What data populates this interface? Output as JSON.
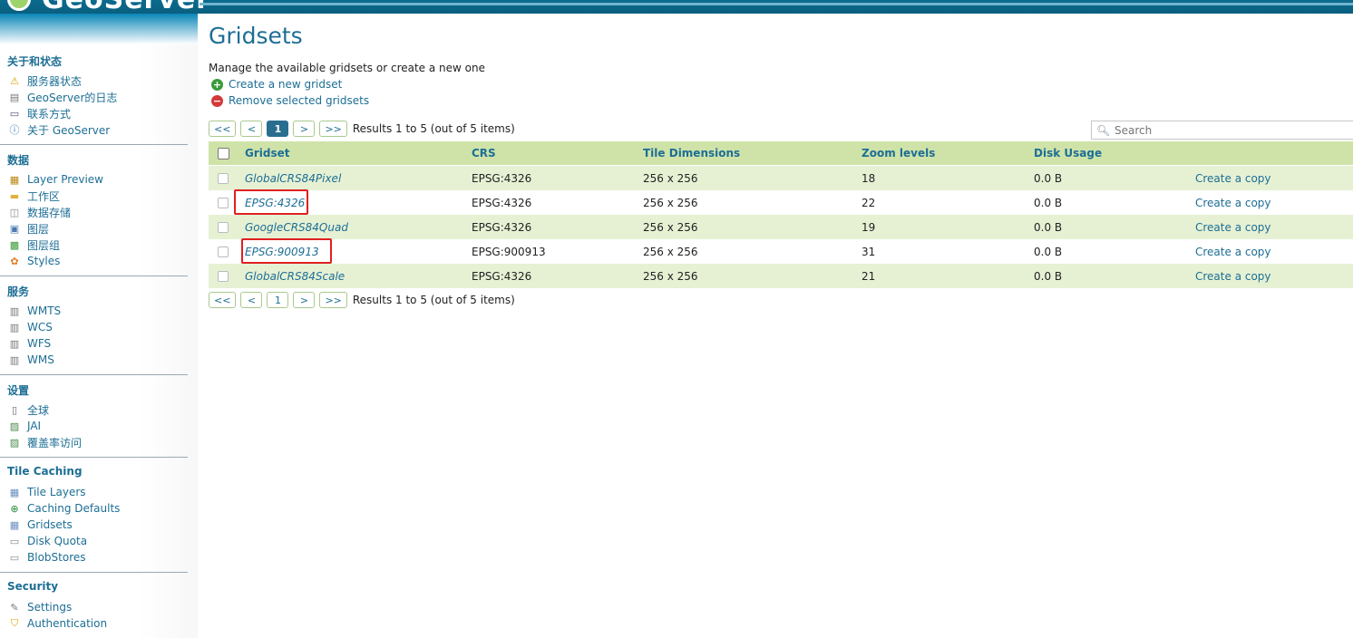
{
  "header": {
    "logo_text": "GeoServer"
  },
  "sidebar": {
    "sections": [
      {
        "title": "关于和状态",
        "items": [
          {
            "label": "服务器状态",
            "icon": "warning-icon"
          },
          {
            "label": "GeoServer的日志",
            "icon": "document-icon"
          },
          {
            "label": "联系方式",
            "icon": "contact-card-icon"
          },
          {
            "label": "关于 GeoServer",
            "icon": "info-icon"
          }
        ]
      },
      {
        "title": "数据",
        "items": [
          {
            "label": "Layer Preview",
            "icon": "map-preview-icon"
          },
          {
            "label": "工作区",
            "icon": "folder-icon"
          },
          {
            "label": "数据存储",
            "icon": "database-icon"
          },
          {
            "label": "图层",
            "icon": "layer-icon"
          },
          {
            "label": "图层组",
            "icon": "layer-group-icon"
          },
          {
            "label": "Styles",
            "icon": "palette-icon"
          }
        ]
      },
      {
        "title": "服务",
        "items": [
          {
            "label": "WMTS",
            "icon": "service-icon"
          },
          {
            "label": "WCS",
            "icon": "service-icon"
          },
          {
            "label": "WFS",
            "icon": "service-icon"
          },
          {
            "label": "WMS",
            "icon": "service-icon"
          }
        ]
      },
      {
        "title": "设置",
        "items": [
          {
            "label": "全球",
            "icon": "server-icon"
          },
          {
            "label": "JAI",
            "icon": "image-icon"
          },
          {
            "label": "覆盖率访问",
            "icon": "image-icon"
          }
        ]
      },
      {
        "title": "Tile Caching",
        "items": [
          {
            "label": "Tile Layers",
            "icon": "grid-icon"
          },
          {
            "label": "Caching Defaults",
            "icon": "globe-icon"
          },
          {
            "label": "Gridsets",
            "icon": "grid-icon"
          },
          {
            "label": "Disk Quota",
            "icon": "disk-icon"
          },
          {
            "label": "BlobStores",
            "icon": "disk-icon"
          }
        ]
      },
      {
        "title": "Security",
        "items": [
          {
            "label": "Settings",
            "icon": "wrench-icon"
          },
          {
            "label": "Authentication",
            "icon": "shield-icon"
          }
        ]
      }
    ]
  },
  "page": {
    "title": "Gridsets",
    "description": "Manage the available gridsets or create a new one",
    "actions": [
      {
        "label": "Create a new gridset",
        "icon": "add-icon",
        "color": "#3a9b3a"
      },
      {
        "label": "Remove selected gridsets",
        "icon": "remove-icon",
        "color": "#d33a3a"
      }
    ]
  },
  "pager": {
    "first": "<<",
    "prev": "<",
    "page": "1",
    "next": ">",
    "last": ">>",
    "results": "Results 1 to 5 (out of 5 items)"
  },
  "search": {
    "placeholder": "Search"
  },
  "table": {
    "columns": [
      "Gridset",
      "CRS",
      "Tile Dimensions",
      "Zoom levels",
      "Disk Usage"
    ],
    "copy_label": "Create a copy",
    "rows": [
      {
        "name": "GlobalCRS84Pixel",
        "crs": "EPSG:4326",
        "dims": "256 x 256",
        "zoom": "18",
        "disk": "0.0 B"
      },
      {
        "name": "EPSG:4326",
        "crs": "EPSG:4326",
        "dims": "256 x 256",
        "zoom": "22",
        "disk": "0.0 B"
      },
      {
        "name": "GoogleCRS84Quad",
        "crs": "EPSG:4326",
        "dims": "256 x 256",
        "zoom": "19",
        "disk": "0.0 B"
      },
      {
        "name": "EPSG:900913",
        "crs": "EPSG:900913",
        "dims": "256 x 256",
        "zoom": "31",
        "disk": "0.0 B"
      },
      {
        "name": "GlobalCRS84Scale",
        "crs": "EPSG:4326",
        "dims": "256 x 256",
        "zoom": "21",
        "disk": "0.0 B"
      }
    ]
  },
  "colors": {
    "accent": "#1d6e95",
    "row_alt": "#e6f1d4",
    "header_row": "#cfe3a9",
    "highlight": "#e02020"
  }
}
